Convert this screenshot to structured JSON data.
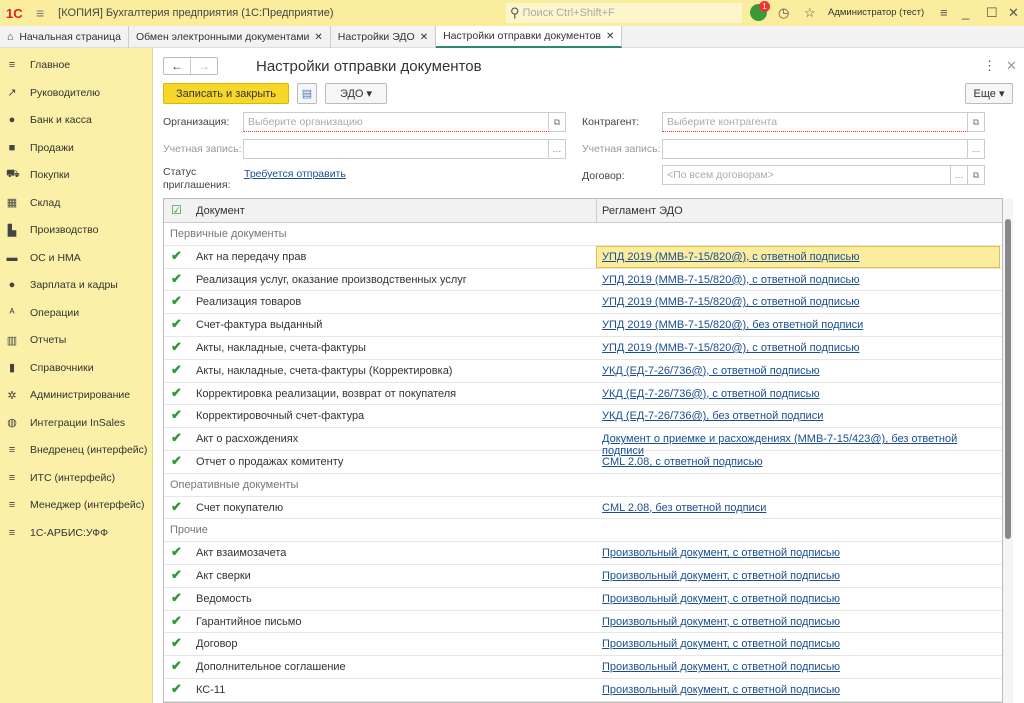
{
  "titlebar": {
    "logo": "1С",
    "title": "[КОПИЯ] Бухгалтерия предприятия  (1С:Предприятие)",
    "search_placeholder": "Поиск Ctrl+Shift+F",
    "notification_count": "1",
    "user": "Администратор (тест)"
  },
  "tabs": [
    {
      "label": "Начальная страница",
      "icon": "home-icon"
    },
    {
      "label": "Обмен электронными документами",
      "closable": true
    },
    {
      "label": "Настройки ЭДО",
      "closable": true
    },
    {
      "label": "Настройки отправки документов",
      "closable": true,
      "active": true
    }
  ],
  "sidebar": {
    "items": [
      {
        "label": "Главное",
        "icon": "≡"
      },
      {
        "label": "Руководителю",
        "icon": "↗"
      },
      {
        "label": "Банк и касса",
        "icon": "●"
      },
      {
        "label": "Продажи",
        "icon": "■"
      },
      {
        "label": "Покупки",
        "icon": "⛟"
      },
      {
        "label": "Склад",
        "icon": "▦"
      },
      {
        "label": "Производство",
        "icon": "▙"
      },
      {
        "label": "ОС и НМА",
        "icon": "▬"
      },
      {
        "label": "Зарплата и кадры",
        "icon": "●"
      },
      {
        "label": "Операции",
        "icon": "ᴬ"
      },
      {
        "label": "Отчеты",
        "icon": "▥"
      },
      {
        "label": "Справочники",
        "icon": "▮"
      },
      {
        "label": "Администрирование",
        "icon": "✲"
      },
      {
        "label": "Интеграции InSales",
        "icon": "◍"
      },
      {
        "label": "Внедренец (интерфейс)",
        "icon": "≡"
      },
      {
        "label": "ИТС (интерфейс)",
        "icon": "≡"
      },
      {
        "label": "Менеджер (интерфейс)",
        "icon": "≡"
      },
      {
        "label": "1С-АРБИС:УФФ",
        "icon": "≡"
      }
    ]
  },
  "form": {
    "title": "Настройки отправки документов",
    "save_close": "Записать и закрыть",
    "edo": "ЭДО",
    "more": "Еще",
    "org_label": "Организация:",
    "org_placeholder": "Выберите организацию",
    "account_label": "Учетная запись:",
    "contractor_label": "Контрагент:",
    "contractor_placeholder": "Выберите контрагента",
    "status_label": "Статус приглашения:",
    "status_value": "Требуется отправить",
    "contract_label": "Договор:",
    "contract_placeholder": "<По всем договорам>"
  },
  "table": {
    "columns": [
      "Документ",
      "Регламент ЭДО"
    ],
    "rows": [
      {
        "group": "Первичные документы"
      },
      {
        "doc": "Акт на передачу прав",
        "reg": "УПД 2019 (ММВ-7-15/820@), с ответной подписью",
        "checked": true,
        "selected": true
      },
      {
        "doc": "Реализация услуг, оказание производственных услуг",
        "reg": "УПД 2019 (ММВ-7-15/820@), с ответной подписью",
        "checked": true
      },
      {
        "doc": "Реализация товаров",
        "reg": "УПД 2019 (ММВ-7-15/820@), с ответной подписью",
        "checked": true
      },
      {
        "doc": "Счет-фактура выданный",
        "reg": "УПД 2019 (ММВ-7-15/820@), без ответной подписи",
        "checked": true
      },
      {
        "doc": "Акты, накладные, счета-фактуры",
        "reg": "УПД 2019 (ММВ-7-15/820@), с ответной подписью",
        "checked": true
      },
      {
        "doc": "Акты, накладные, счета-фактуры (Корректировка)",
        "reg": "УКД (ЕД-7-26/736@), с ответной подписью",
        "checked": true
      },
      {
        "doc": "Корректировка реализации, возврат от покупателя",
        "reg": "УКД (ЕД-7-26/736@), с ответной подписью",
        "checked": true
      },
      {
        "doc": "Корректировочный счет-фактура",
        "reg": "УКД (ЕД-7-26/736@), без ответной подписи",
        "checked": true
      },
      {
        "doc": "Акт о расхождениях",
        "reg": "Документ о приемке и расхождениях (ММВ-7-15/423@), без ответной подписи",
        "checked": true
      },
      {
        "doc": "Отчет о продажах комитенту",
        "reg": "CML 2.08, с ответной подписью",
        "checked": true
      },
      {
        "group": "Оперативные документы"
      },
      {
        "doc": "Счет покупателю",
        "reg": "CML 2.08, без ответной подписи",
        "checked": true
      },
      {
        "group": "Прочие"
      },
      {
        "doc": "Акт взаимозачета",
        "reg": "Произвольный документ, с ответной подписью",
        "checked": true
      },
      {
        "doc": "Акт сверки",
        "reg": "Произвольный документ, с ответной подписью",
        "checked": true
      },
      {
        "doc": "Ведомость",
        "reg": "Произвольный документ, с ответной подписью",
        "checked": true
      },
      {
        "doc": "Гарантийное письмо",
        "reg": "Произвольный документ, с ответной подписью",
        "checked": true
      },
      {
        "doc": "Договор",
        "reg": "Произвольный документ, с ответной подписью",
        "checked": true
      },
      {
        "doc": "Дополнительное соглашение",
        "reg": "Произвольный документ, с ответной подписью",
        "checked": true
      },
      {
        "doc": "КС-11",
        "reg": "Произвольный документ, с ответной подписью",
        "checked": true
      }
    ]
  },
  "colors": {
    "titlebar": "#fbed9e",
    "sidebar": "#fbf0a8",
    "primary_button": "#f7d829",
    "link": "#1a4f8f",
    "check": "#2a9a3a"
  }
}
